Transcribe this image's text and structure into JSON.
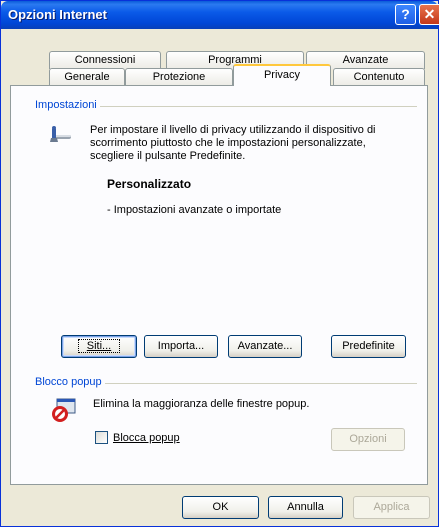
{
  "window": {
    "title": "Opzioni Internet",
    "help_glyph": "?",
    "close_glyph": "✕"
  },
  "tabs_back": [
    {
      "label": "Connessioni"
    },
    {
      "label": "Programmi"
    },
    {
      "label": "Avanzate"
    }
  ],
  "tabs_front": [
    {
      "label": "Generale"
    },
    {
      "label": "Protezione"
    },
    {
      "label": "Privacy",
      "active": true
    },
    {
      "label": "Contenuto"
    }
  ],
  "settings": {
    "group_label": "Impostazioni",
    "description": "Per impostare il livello di privacy utilizzando il dispositivo di scorrimento piuttosto che le impostazioni personalizzate, scegliere il pulsante Predefinite.",
    "level_title": "Personalizzato",
    "level_detail": "- Impostazioni avanzate o importate",
    "buttons": {
      "sites": "Siti...",
      "import": "Importa...",
      "advanced": "Avanzate...",
      "default": "Predefinite"
    }
  },
  "popup": {
    "group_label": "Blocco popup",
    "description": "Elimina la maggioranza delle finestre popup.",
    "checkbox_label": "Blocca popup",
    "checked": false,
    "options_button": "Opzioni"
  },
  "footer": {
    "ok": "OK",
    "cancel": "Annulla",
    "apply": "Applica"
  }
}
